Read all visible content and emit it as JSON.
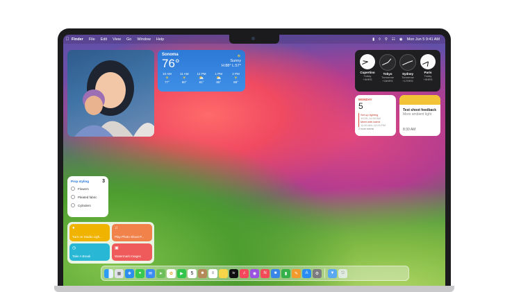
{
  "menubar": {
    "apple_icon": "apple-icon",
    "items": [
      "Finder",
      "File",
      "Edit",
      "View",
      "Go",
      "Window",
      "Help"
    ],
    "datetime": "Mon Jun 5  9:41 AM"
  },
  "weather": {
    "location": "Sonoma",
    "temp": "76°",
    "condition": "Sunny",
    "hilo": "H:88° L:57°",
    "hours": [
      {
        "time": "10 AM",
        "temp": "77°"
      },
      {
        "time": "11 AM",
        "temp": "80°"
      },
      {
        "time": "12 PM",
        "temp": "81°"
      },
      {
        "time": "1 PM",
        "temp": "85°"
      },
      {
        "time": "2 PM",
        "temp": "88°"
      }
    ]
  },
  "clocks": [
    {
      "city": "Cupertino",
      "day": "Today",
      "offset": "+0HRS"
    },
    {
      "city": "Tokyo",
      "day": "Tomorrow",
      "offset": "+16HRS"
    },
    {
      "city": "Sydney",
      "day": "Tomorrow",
      "offset": "+17HRS"
    },
    {
      "city": "Paris",
      "day": "Today",
      "offset": "+9HRS"
    }
  ],
  "calendar": {
    "dayname": "MONDAY",
    "daynum": "5",
    "events": [
      {
        "title": "Set up lighting",
        "time": "10:00–11:00 AM"
      },
      {
        "title": "Meet with talent",
        "time": "11:00 AM–12:00 PM"
      }
    ],
    "more": "2 more events"
  },
  "notes": {
    "title": "Test shoot feedback",
    "subtitle": "More ambient light",
    "time": "8:30 AM"
  },
  "reminders": {
    "title": "Prop styling",
    "count": "3",
    "items": [
      "Flowers",
      "Pleated fabric",
      "Cylinders"
    ]
  },
  "shortcuts": [
    {
      "label": "Turn on Studio Ligh...",
      "color": "#f0b400",
      "icon": "lightbulb-icon"
    },
    {
      "label": "Play Photo Shoot P...",
      "color": "#f0824a",
      "icon": "music-note-icon"
    },
    {
      "label": "Take A Break",
      "color": "#28b8d6",
      "icon": "timer-icon"
    },
    {
      "label": "Watermark Images",
      "color": "#ef5a5a",
      "icon": "photo-icon"
    }
  ],
  "dock": {
    "calendar_day": "5",
    "tv_label": "tv",
    "icons": [
      "finder-icon",
      "launchpad-icon",
      "safari-icon",
      "messages-icon",
      "mail-icon",
      "maps-icon",
      "photos-icon",
      "facetime-icon",
      "calendar-icon",
      "contacts-icon",
      "reminders-icon",
      "notes-icon",
      "tv-icon",
      "music-icon",
      "podcasts-icon",
      "news-icon",
      "keynote-icon",
      "numbers-icon",
      "pages-icon",
      "app-store-icon",
      "system-settings-icon",
      "downloads-folder-icon",
      "trash-icon"
    ]
  }
}
